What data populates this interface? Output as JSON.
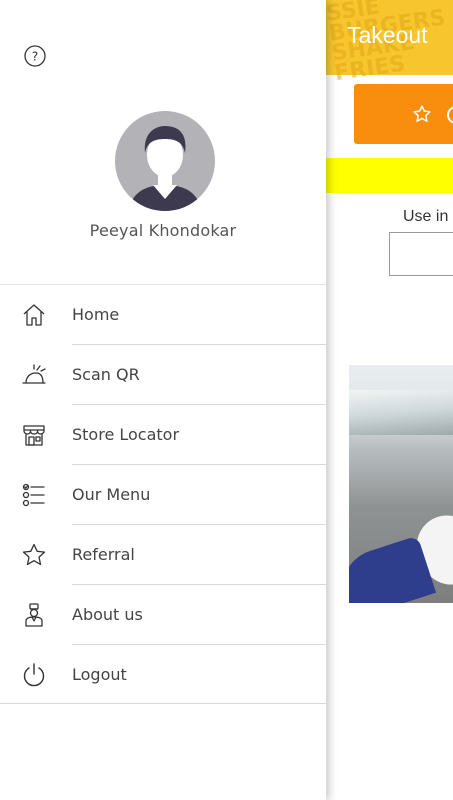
{
  "background_app": {
    "header_title": "Takeout",
    "header_pattern_words": [
      "SSIE",
      "BURGERS",
      "SHAKE",
      "FRIES"
    ],
    "use_label": "Use in",
    "colors": {
      "header": "#f7c62f",
      "orange_button": "#f98e0e",
      "yellow_bar": "#ffff00"
    }
  },
  "drawer": {
    "user_name": "Peeyal Khondokar",
    "menu": [
      {
        "label": "Home",
        "icon": "home-icon"
      },
      {
        "label": "Scan QR",
        "icon": "scan-qr-icon"
      },
      {
        "label": "Store Locator",
        "icon": "store-icon"
      },
      {
        "label": "Our Menu",
        "icon": "menu-list-icon"
      },
      {
        "label": "Referral",
        "icon": "star-icon"
      },
      {
        "label": "About us",
        "icon": "chef-icon"
      },
      {
        "label": "Logout",
        "icon": "power-icon"
      }
    ]
  }
}
